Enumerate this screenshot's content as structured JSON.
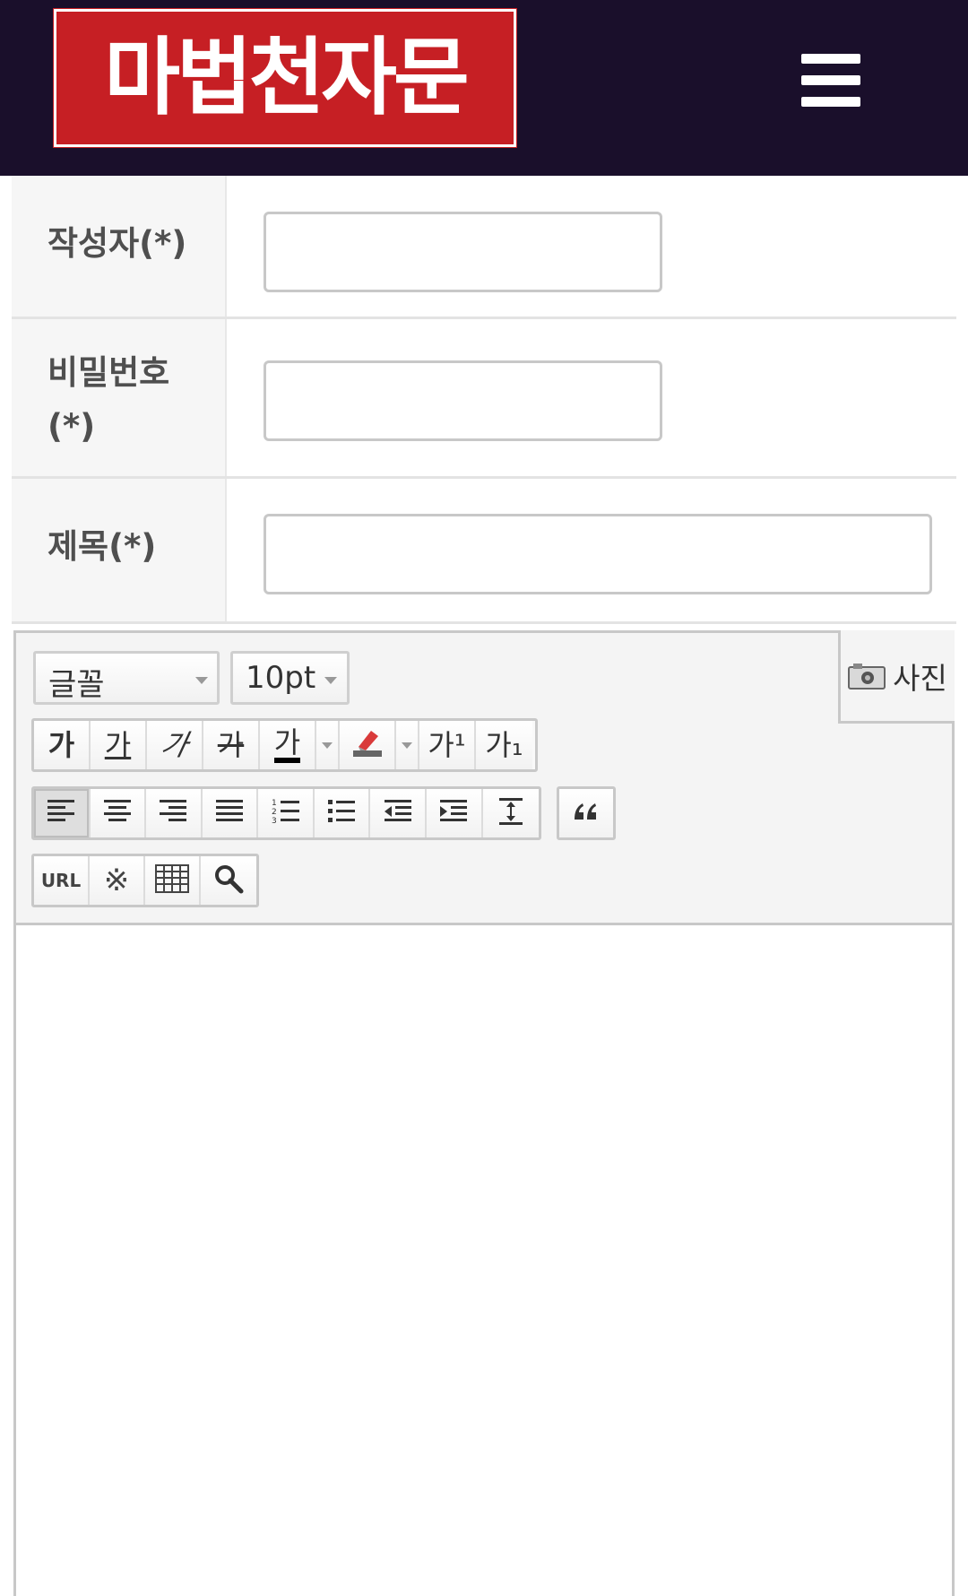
{
  "header": {
    "logo_text": "마법천자문",
    "menu_icon": "hamburger-menu-icon",
    "background_color": "#1a0f2b",
    "logo_color": "#c61f24"
  },
  "form": {
    "author_label": "작성자(*)",
    "author_value": "",
    "password_label_line1": "비밀번호",
    "password_label_line2": "(*)",
    "password_value": "",
    "title_label": "제목(*)",
    "title_value": ""
  },
  "editor": {
    "font_select": "글꼴",
    "size_select": "10pt",
    "photo_button": "사진",
    "format_buttons": [
      {
        "name": "bold",
        "glyph": "가"
      },
      {
        "name": "underline",
        "glyph": "가"
      },
      {
        "name": "italic",
        "glyph": "가"
      },
      {
        "name": "strikethrough",
        "glyph": "가"
      },
      {
        "name": "font-color",
        "glyph": "가"
      },
      {
        "name": "superscript",
        "glyph": "가¹"
      },
      {
        "name": "subscript",
        "glyph": "가₁"
      }
    ],
    "url_button": "URL",
    "active_alignment": "align-left",
    "content": ""
  }
}
